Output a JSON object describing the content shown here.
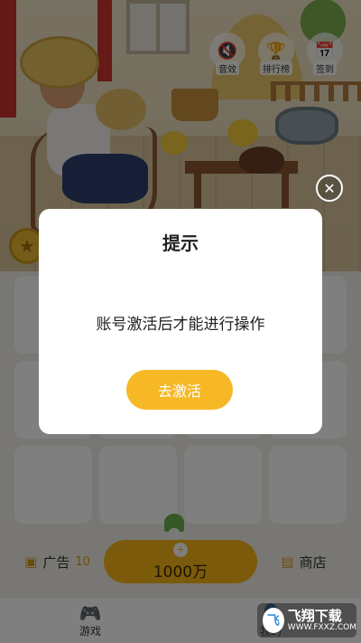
{
  "header_icons": [
    {
      "label": "音效",
      "icon": "speaker-mute-icon",
      "glyph": "🔇"
    },
    {
      "label": "排行榜",
      "icon": "trophy-icon",
      "glyph": "🏆"
    },
    {
      "label": "签到",
      "icon": "calendar-icon",
      "glyph": "📅"
    }
  ],
  "bottom_bar": {
    "ads_label": "广告",
    "ads_count": "10",
    "mid_plus": "+",
    "mid_value": "1000万",
    "shop_label": "商店"
  },
  "tabs": [
    {
      "label": "游戏",
      "glyph": "🎮"
    },
    {
      "label": "我的",
      "glyph": "👤"
    }
  ],
  "dialog": {
    "title": "提示",
    "message": "账号激活后才能进行操作",
    "button_label": "去激活",
    "close_glyph": "✕"
  },
  "watermark": {
    "logo_glyph": "飞",
    "text": "飞翔下载",
    "url": "WWW.FXXZ.COM"
  },
  "colors": {
    "accent": "#f6b825",
    "overlay": "rgba(0,0,0,0.5)",
    "door_red": "#c9342c"
  }
}
